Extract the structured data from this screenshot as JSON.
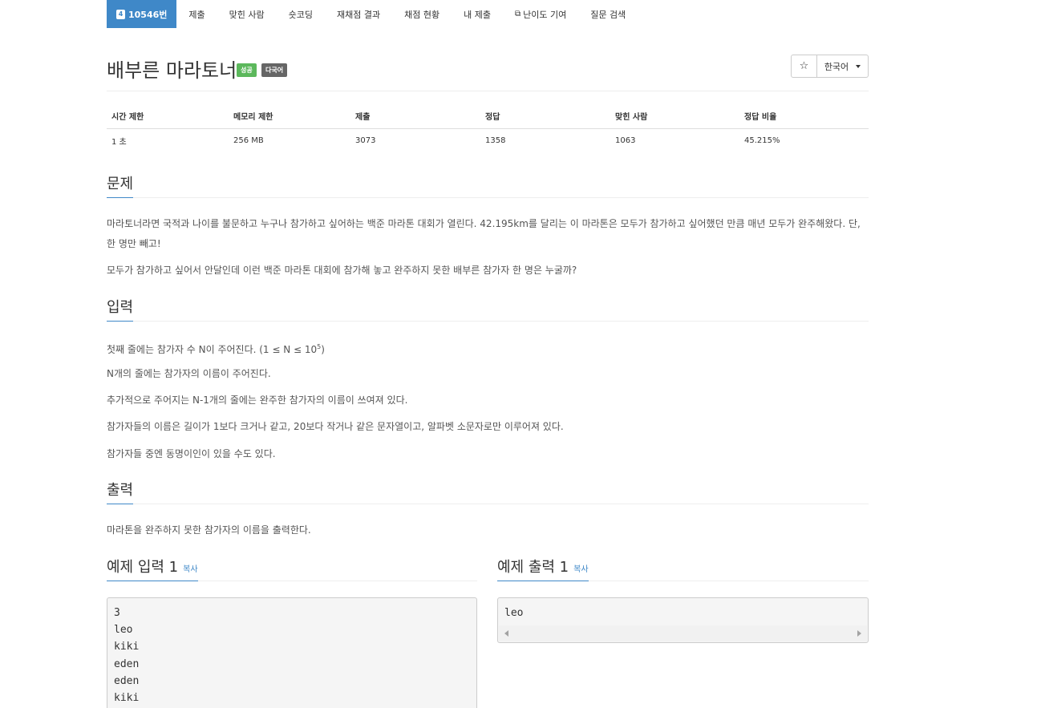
{
  "nav": {
    "problem_id": "10546번",
    "problem_badge": "4",
    "items": [
      "제출",
      "맞힌 사람",
      "숏코딩",
      "재채점 결과",
      "채점 현황",
      "내 제출"
    ],
    "difficulty": "난이도 기여",
    "search": "질문 검색"
  },
  "problem": {
    "title": "배부른 마라토너",
    "label_success": "성공",
    "label_lang": "다국어",
    "star": "☆",
    "language": "한국어"
  },
  "info": {
    "headers": [
      "시간 제한",
      "메모리 제한",
      "제출",
      "정답",
      "맞힌 사람",
      "정답 비율"
    ],
    "values": [
      "1 초",
      "256 MB",
      "3073",
      "1358",
      "1063",
      "45.215%"
    ]
  },
  "sections": {
    "problem": "문제",
    "input": "입력",
    "output": "출력",
    "sample_input": "예제 입력 1",
    "sample_output": "예제 출력 1",
    "copy": "복사"
  },
  "description": {
    "p1": "마라토너라면 국적과 나이를 불문하고 누구나 참가하고 싶어하는 백준 마라톤 대회가 열린다. 42.195km를 달리는 이 마라톤은 모두가 참가하고 싶어했던 만큼 매년 모두가 완주해왔다. 단, 한 명만 빼고!",
    "p2": "모두가 참가하고 싶어서 안달인데 이런 백준 마라톤 대회에 참가해 놓고 완주하지 못한 배부른 참가자 한 명은 누굴까?"
  },
  "input_desc": {
    "l1": "첫째 줄에는 참가자 수 N이 주어진다. (1 ≤ N ≤ 10",
    "l1_sup": "5",
    "l1_end": ")",
    "l2": "N개의 줄에는 참가자의 이름이 주어진다.",
    "l3": "추가적으로 주어지는 N-1개의 줄에는 완주한 참가자의 이름이 쓰여져 있다.",
    "l4": "참가자들의 이름은 길이가 1보다 크거나 같고, 20보다 작거나 같은 문자열이고, 알파벳 소문자로만 이루어져 있다.",
    "l5": "참가자들 중엔 동명이인이 있을 수도 있다."
  },
  "output_desc": "마라톤을 완주하지 못한 참가자의 이름을 출력한다.",
  "sample_input_lines": [
    "3",
    "leo",
    "kiki",
    "eden",
    "eden",
    "kiki"
  ],
  "sample_output_lines": [
    "leo"
  ]
}
